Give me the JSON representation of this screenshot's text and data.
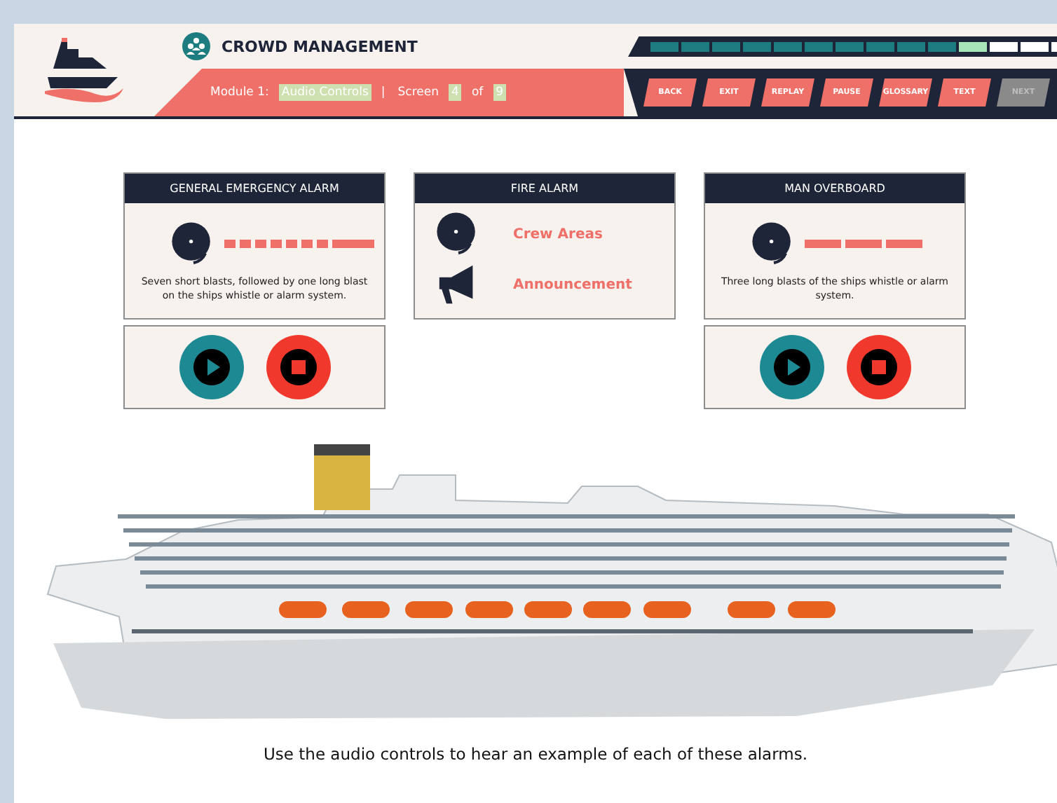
{
  "header": {
    "title": "CROWD MANAGEMENT",
    "progress": [
      {
        "kind": "done"
      },
      {
        "kind": "done"
      },
      {
        "kind": "done"
      },
      {
        "kind": "done"
      },
      {
        "kind": "done"
      },
      {
        "kind": "done"
      },
      {
        "kind": "done"
      },
      {
        "kind": "done"
      },
      {
        "kind": "done"
      },
      {
        "kind": "done"
      },
      {
        "kind": "current"
      },
      {
        "kind": "todo"
      },
      {
        "kind": "todo"
      },
      {
        "kind": "todo"
      }
    ],
    "module_line": [
      {
        "text": "Module 1:",
        "highlighted": false
      },
      {
        "text": "Audio Controls",
        "highlighted": true
      },
      {
        "text": "|",
        "highlighted": false
      },
      {
        "text": "Screen",
        "highlighted": false
      },
      {
        "text": "4",
        "highlighted": true
      },
      {
        "text": "of",
        "highlighted": false
      },
      {
        "text": "9",
        "highlighted": true
      }
    ],
    "nav_buttons": [
      {
        "label": "BACK",
        "disabled": false
      },
      {
        "label": "EXIT",
        "disabled": false
      },
      {
        "label": "REPLAY",
        "disabled": false
      },
      {
        "label": "PAUSE",
        "disabled": false
      },
      {
        "label": "GLOSSARY",
        "disabled": false
      },
      {
        "label": "TEXT",
        "disabled": false
      },
      {
        "label": "NEXT",
        "disabled": true
      }
    ]
  },
  "alarms": [
    {
      "kind": "pattern",
      "title": "GENERAL EMERGENCY ALARM",
      "blasts": [
        {
          "kind": "short"
        },
        {
          "kind": "short"
        },
        {
          "kind": "short"
        },
        {
          "kind": "short"
        },
        {
          "kind": "short"
        },
        {
          "kind": "short"
        },
        {
          "kind": "short"
        },
        {
          "kind": "long"
        }
      ],
      "description": "Seven short blasts, followed by one long blast on the ships whistle or alarm system.",
      "controls": true
    },
    {
      "kind": "list",
      "title": "FIRE ALARM",
      "items": [
        {
          "kind": "bell",
          "text": "Crew Areas"
        },
        {
          "kind": "megaphone",
          "text": "Announcement"
        }
      ]
    },
    {
      "kind": "pattern",
      "title": "MAN OVERBOARD",
      "blasts": [
        {
          "kind": "long"
        },
        {
          "kind": "long"
        },
        {
          "kind": "long"
        }
      ],
      "description": "Three long blasts of the ships whistle or alarm system.",
      "controls": true
    }
  ],
  "caption": "Use the audio controls to hear an example of each of these alarms."
}
